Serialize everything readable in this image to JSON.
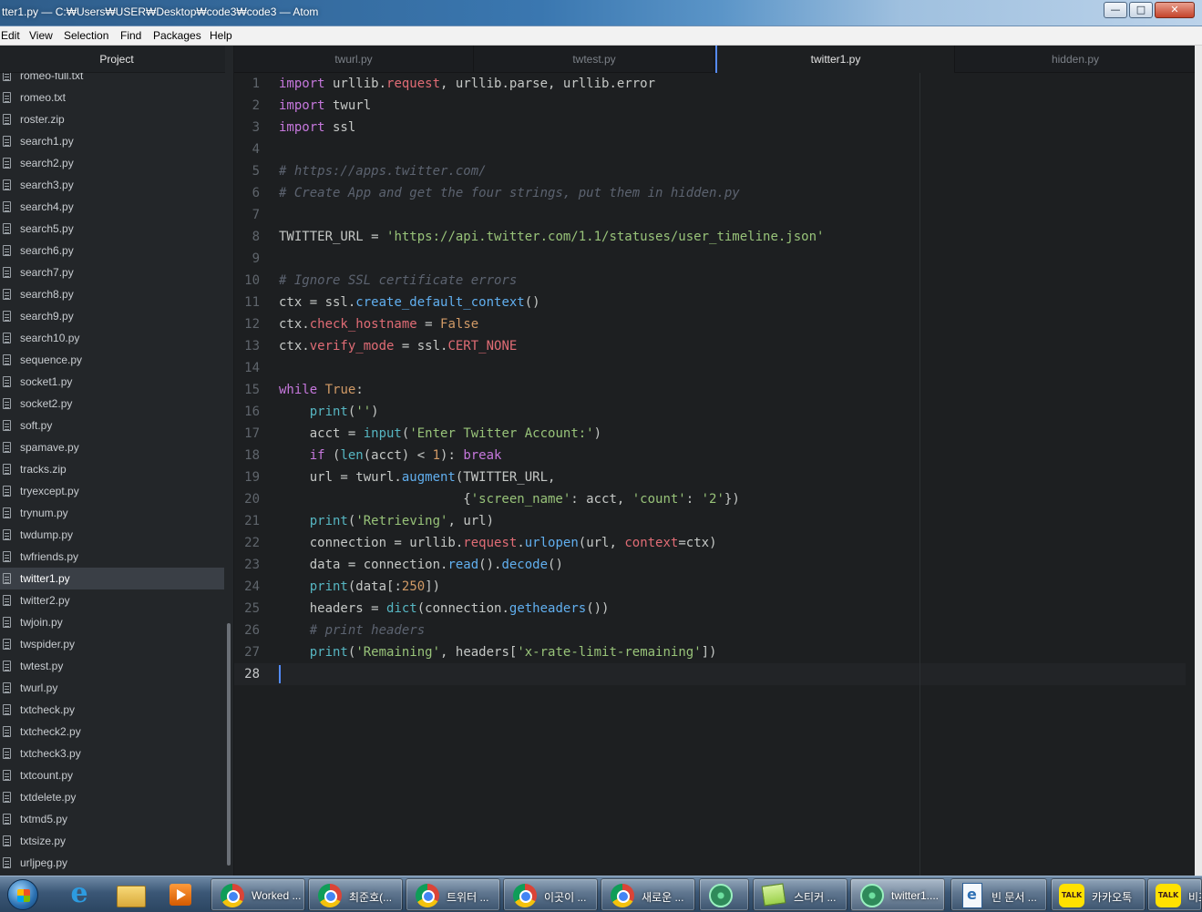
{
  "window": {
    "title": "tter1.py — C:₩Users₩USER₩Desktop₩code3₩code3 — Atom",
    "controls": [
      "minimize",
      "maximize",
      "close"
    ]
  },
  "menu": [
    "Edit",
    "View",
    "Selection",
    "Find",
    "Packages",
    "Help"
  ],
  "sidebar": {
    "title": "Project",
    "files": [
      "romeo-full.txt",
      "romeo.txt",
      "roster.zip",
      "search1.py",
      "search2.py",
      "search3.py",
      "search4.py",
      "search5.py",
      "search6.py",
      "search7.py",
      "search8.py",
      "search9.py",
      "search10.py",
      "sequence.py",
      "socket1.py",
      "socket2.py",
      "soft.py",
      "spamave.py",
      "tracks.zip",
      "tryexcept.py",
      "trynum.py",
      "twdump.py",
      "twfriends.py",
      "twitter1.py",
      "twitter2.py",
      "twjoin.py",
      "twspider.py",
      "twtest.py",
      "twurl.py",
      "txtcheck.py",
      "txtcheck2.py",
      "txtcheck3.py",
      "txtcount.py",
      "txtdelete.py",
      "txtmd5.py",
      "txtsize.py",
      "urljpeg.py"
    ],
    "selected": "twitter1.py"
  },
  "tabs": [
    {
      "label": "twurl.py",
      "active": false
    },
    {
      "label": "twtest.py",
      "active": false
    },
    {
      "label": "twitter1.py",
      "active": true
    },
    {
      "label": "hidden.py",
      "active": false
    }
  ],
  "editor": {
    "line_numbers": [
      "1",
      "2",
      "3",
      "4",
      "5",
      "6",
      "7",
      "8",
      "9",
      "10",
      "11",
      "12",
      "13",
      "14",
      "15",
      "16",
      "17",
      "18",
      "19",
      "20",
      "21",
      "22",
      "23",
      "24",
      "25",
      "26",
      "27",
      "28"
    ],
    "current_line": "28",
    "lines": [
      "import urllib.request, urllib.parse, urllib.error",
      "import twurl",
      "import ssl",
      "",
      "# https://apps.twitter.com/",
      "# Create App and get the four strings, put them in hidden.py",
      "",
      "TWITTER_URL = 'https://api.twitter.com/1.1/statuses/user_timeline.json'",
      "",
      "# Ignore SSL certificate errors",
      "ctx = ssl.create_default_context()",
      "ctx.check_hostname = False",
      "ctx.verify_mode = ssl.CERT_NONE",
      "",
      "while True:",
      "    print('')",
      "    acct = input('Enter Twitter Account:')",
      "    if (len(acct) < 1): break",
      "    url = twurl.augment(TWITTER_URL,",
      "                        {'screen_name': acct, 'count': '2'})",
      "    print('Retrieving', url)",
      "    connection = urllib.request.urlopen(url, context=ctx)",
      "    data = connection.read().decode()",
      "    print(data[:250])",
      "    headers = dict(connection.getheaders())",
      "    # print headers",
      "    print('Remaining', headers['x-rate-limit-remaining'])",
      ""
    ]
  },
  "taskbar": {
    "tasks": [
      {
        "label": "Worked ...",
        "icon": "chrome-icon"
      },
      {
        "label": "최준호(...",
        "icon": "chrome-icon"
      },
      {
        "label": "트위터 ...",
        "icon": "chrome-icon"
      },
      {
        "label": "이곳이 ...",
        "icon": "chrome-icon"
      },
      {
        "label": "새로운 ...",
        "icon": "chrome-icon"
      },
      {
        "label": "",
        "icon": "atom-icon"
      },
      {
        "label": "스티커 ...",
        "icon": "sticky-notes-icon"
      },
      {
        "label": "twitter1....",
        "icon": "atom-icon"
      },
      {
        "label": "빈 문서 ...",
        "icon": "document-icon"
      },
      {
        "label": "카카오톡",
        "icon": "kakaotalk-icon"
      },
      {
        "label": "비즈",
        "icon": "kakaotalk-icon"
      }
    ],
    "pinned": [
      "start-orb",
      "internet-explorer-icon",
      "file-explorer-icon",
      "media-player-icon"
    ]
  },
  "colors": {
    "editor_bg": "#1d1f21",
    "keyword": "#c678dd",
    "string": "#98c379",
    "comment": "#5c6370",
    "function": "#61afef",
    "property": "#e06c75",
    "number": "#d19a66",
    "builtin": "#56b6c2",
    "accent": "#528bff"
  }
}
